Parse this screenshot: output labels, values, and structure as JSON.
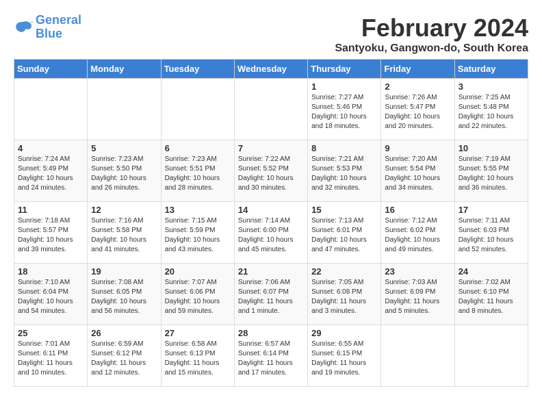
{
  "logo": {
    "line1": "General",
    "line2": "Blue"
  },
  "title": "February 2024",
  "subtitle": "Santyoku, Gangwon-do, South Korea",
  "days_of_week": [
    "Sunday",
    "Monday",
    "Tuesday",
    "Wednesday",
    "Thursday",
    "Friday",
    "Saturday"
  ],
  "weeks": [
    [
      {
        "day": "",
        "info": ""
      },
      {
        "day": "",
        "info": ""
      },
      {
        "day": "",
        "info": ""
      },
      {
        "day": "",
        "info": ""
      },
      {
        "day": "1",
        "info": "Sunrise: 7:27 AM\nSunset: 5:46 PM\nDaylight: 10 hours\nand 18 minutes."
      },
      {
        "day": "2",
        "info": "Sunrise: 7:26 AM\nSunset: 5:47 PM\nDaylight: 10 hours\nand 20 minutes."
      },
      {
        "day": "3",
        "info": "Sunrise: 7:25 AM\nSunset: 5:48 PM\nDaylight: 10 hours\nand 22 minutes."
      }
    ],
    [
      {
        "day": "4",
        "info": "Sunrise: 7:24 AM\nSunset: 5:49 PM\nDaylight: 10 hours\nand 24 minutes."
      },
      {
        "day": "5",
        "info": "Sunrise: 7:23 AM\nSunset: 5:50 PM\nDaylight: 10 hours\nand 26 minutes."
      },
      {
        "day": "6",
        "info": "Sunrise: 7:23 AM\nSunset: 5:51 PM\nDaylight: 10 hours\nand 28 minutes."
      },
      {
        "day": "7",
        "info": "Sunrise: 7:22 AM\nSunset: 5:52 PM\nDaylight: 10 hours\nand 30 minutes."
      },
      {
        "day": "8",
        "info": "Sunrise: 7:21 AM\nSunset: 5:53 PM\nDaylight: 10 hours\nand 32 minutes."
      },
      {
        "day": "9",
        "info": "Sunrise: 7:20 AM\nSunset: 5:54 PM\nDaylight: 10 hours\nand 34 minutes."
      },
      {
        "day": "10",
        "info": "Sunrise: 7:19 AM\nSunset: 5:55 PM\nDaylight: 10 hours\nand 36 minutes."
      }
    ],
    [
      {
        "day": "11",
        "info": "Sunrise: 7:18 AM\nSunset: 5:57 PM\nDaylight: 10 hours\nand 39 minutes."
      },
      {
        "day": "12",
        "info": "Sunrise: 7:16 AM\nSunset: 5:58 PM\nDaylight: 10 hours\nand 41 minutes."
      },
      {
        "day": "13",
        "info": "Sunrise: 7:15 AM\nSunset: 5:59 PM\nDaylight: 10 hours\nand 43 minutes."
      },
      {
        "day": "14",
        "info": "Sunrise: 7:14 AM\nSunset: 6:00 PM\nDaylight: 10 hours\nand 45 minutes."
      },
      {
        "day": "15",
        "info": "Sunrise: 7:13 AM\nSunset: 6:01 PM\nDaylight: 10 hours\nand 47 minutes."
      },
      {
        "day": "16",
        "info": "Sunrise: 7:12 AM\nSunset: 6:02 PM\nDaylight: 10 hours\nand 49 minutes."
      },
      {
        "day": "17",
        "info": "Sunrise: 7:11 AM\nSunset: 6:03 PM\nDaylight: 10 hours\nand 52 minutes."
      }
    ],
    [
      {
        "day": "18",
        "info": "Sunrise: 7:10 AM\nSunset: 6:04 PM\nDaylight: 10 hours\nand 54 minutes."
      },
      {
        "day": "19",
        "info": "Sunrise: 7:08 AM\nSunset: 6:05 PM\nDaylight: 10 hours\nand 56 minutes."
      },
      {
        "day": "20",
        "info": "Sunrise: 7:07 AM\nSunset: 6:06 PM\nDaylight: 10 hours\nand 59 minutes."
      },
      {
        "day": "21",
        "info": "Sunrise: 7:06 AM\nSunset: 6:07 PM\nDaylight: 11 hours\nand 1 minute."
      },
      {
        "day": "22",
        "info": "Sunrise: 7:05 AM\nSunset: 6:08 PM\nDaylight: 11 hours\nand 3 minutes."
      },
      {
        "day": "23",
        "info": "Sunrise: 7:03 AM\nSunset: 6:09 PM\nDaylight: 11 hours\nand 5 minutes."
      },
      {
        "day": "24",
        "info": "Sunrise: 7:02 AM\nSunset: 6:10 PM\nDaylight: 11 hours\nand 8 minutes."
      }
    ],
    [
      {
        "day": "25",
        "info": "Sunrise: 7:01 AM\nSunset: 6:11 PM\nDaylight: 11 hours\nand 10 minutes."
      },
      {
        "day": "26",
        "info": "Sunrise: 6:59 AM\nSunset: 6:12 PM\nDaylight: 11 hours\nand 12 minutes."
      },
      {
        "day": "27",
        "info": "Sunrise: 6:58 AM\nSunset: 6:13 PM\nDaylight: 11 hours\nand 15 minutes."
      },
      {
        "day": "28",
        "info": "Sunrise: 6:57 AM\nSunset: 6:14 PM\nDaylight: 11 hours\nand 17 minutes."
      },
      {
        "day": "29",
        "info": "Sunrise: 6:55 AM\nSunset: 6:15 PM\nDaylight: 11 hours\nand 19 minutes."
      },
      {
        "day": "",
        "info": ""
      },
      {
        "day": "",
        "info": ""
      }
    ]
  ]
}
